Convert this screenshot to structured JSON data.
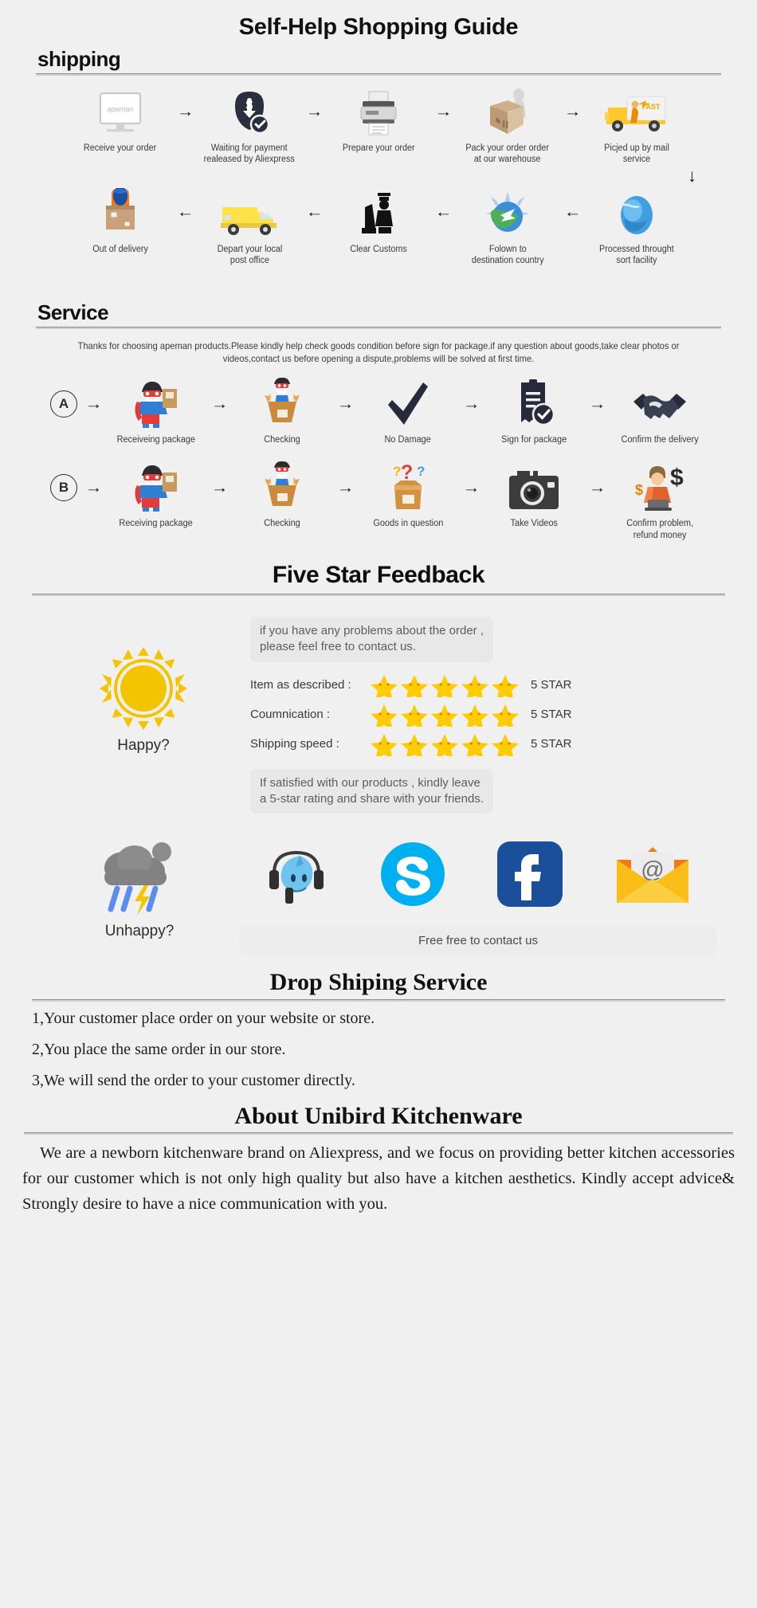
{
  "page": {
    "title": "Self-Help Shopping Guide",
    "background": "#f0f0f0"
  },
  "shipping": {
    "heading": "shipping",
    "row1": [
      {
        "label": "Receive your order",
        "icon": "monitor-apeman-icon"
      },
      {
        "label": "Waiting for payment\nrealeased by Aliexpress",
        "icon": "payment-shield-icon"
      },
      {
        "label": "Prepare your order",
        "icon": "printer-icon"
      },
      {
        "label": "Pack your order order\nat our warehouse",
        "icon": "packing-box-icon"
      },
      {
        "label": "Picjed up by mail service",
        "icon": "fast-truck-icon"
      }
    ],
    "row2": [
      {
        "label": "Out of delivery",
        "icon": "courier-box-icon"
      },
      {
        "label": "Depart your local\npost office",
        "icon": "yellow-van-icon"
      },
      {
        "label": "Clear Customs",
        "icon": "customs-officer-icon"
      },
      {
        "label": "Folown to\ndestination country",
        "icon": "globe-plane-icon"
      },
      {
        "label": "Processed throught\nsort facility",
        "icon": "blue-globe-icon"
      }
    ],
    "arrow_right": "→",
    "arrow_left": "←",
    "arrow_down": "↓"
  },
  "service": {
    "heading": "Service",
    "blurb": "Thanks for choosing apeman products.Please kindly help check goods condition before sign for package.if any question about goods,take clear photos or videos,contact us before opening a dispute,problems will be solved at first time.",
    "flow_a": {
      "marker": "A",
      "steps": [
        {
          "label": "Receiveing package",
          "icon": "hero-with-parcel-icon"
        },
        {
          "label": "Checking",
          "icon": "hero-opening-box-icon"
        },
        {
          "label": "No Damage",
          "icon": "checkmark-icon"
        },
        {
          "label": "Sign for package",
          "icon": "signed-document-icon"
        },
        {
          "label": "Confirm the delivery",
          "icon": "handshake-icon"
        }
      ]
    },
    "flow_b": {
      "marker": "B",
      "steps": [
        {
          "label": "Receiving package",
          "icon": "hero-with-parcel-icon"
        },
        {
          "label": "Checking",
          "icon": "hero-opening-box-icon"
        },
        {
          "label": "Goods in question",
          "icon": "question-box-icon"
        },
        {
          "label": "Take Videos",
          "icon": "camera-icon"
        },
        {
          "label": "Confirm problem,\nrefund money",
          "icon": "agent-refund-icon"
        }
      ]
    }
  },
  "feedback": {
    "heading": "Five Star Feedback",
    "top_bubble": "if you have any problems about the order ,\nplease feel free to contact us.",
    "bottom_bubble": "If satisfied with our products ,  kindly leave\na 5-star rating and share with your friends.",
    "happy_label": "Happy?",
    "happy_icon": "sun-icon",
    "ratings": [
      {
        "label": "Item as described :",
        "stars": 5,
        "value": "5 STAR"
      },
      {
        "label": "Coumnication :",
        "stars": 5,
        "value": "5 STAR"
      },
      {
        "label": "Shipping speed :",
        "stars": 5,
        "value": "5 STAR"
      }
    ],
    "star_color": "#ffcc00"
  },
  "contact": {
    "unhappy_label": "Unhappy?",
    "unhappy_icon": "storm-cloud-icon",
    "channels": [
      {
        "name": "trademanager-icon",
        "color": "#4ab3e8"
      },
      {
        "name": "skype-icon",
        "color": "#00aff0"
      },
      {
        "name": "facebook-icon",
        "color": "#1b4f9c"
      },
      {
        "name": "email-icon",
        "color": "#fbbe18"
      }
    ],
    "bar_label": "Free free to contact us"
  },
  "dropship": {
    "heading": "Drop Shiping Service",
    "items": [
      "1,Your customer place order on your website or store.",
      "2,You place the same order in our store.",
      "3,We will send the order to your customer directly."
    ]
  },
  "about": {
    "heading": "About Unibird Kitchenware",
    "body": "We are a newborn kitchenware brand on Aliexpress, and we focus on providing better kitchen accessories for our customer which is not only high quality but also have a kitchen aesthetics. Kindly accept advice& Strongly desire to have a nice communication with you."
  }
}
